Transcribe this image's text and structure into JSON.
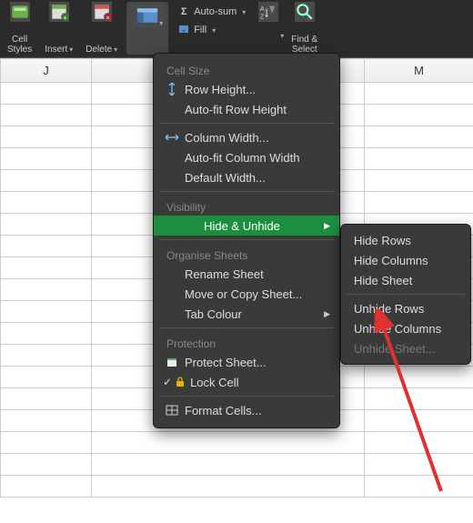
{
  "ribbon": {
    "cell_styles": "Cell\nStyles",
    "insert": "Insert",
    "delete": "Delete",
    "autosum": "Auto-sum",
    "fill": "Fill",
    "find_select": "Find &\nSelect"
  },
  "columns": [
    "J",
    "M"
  ],
  "menu": {
    "sections": {
      "cell_size": "Cell Size",
      "visibility": "Visibility",
      "organise": "Organise Sheets",
      "protection": "Protection"
    },
    "items": {
      "row_height": "Row Height...",
      "autofit_row": "Auto-fit Row Height",
      "column_width": "Column Width...",
      "autofit_col": "Auto-fit Column Width",
      "default_width": "Default Width...",
      "hide_unhide": "Hide & Unhide",
      "rename_sheet": "Rename Sheet",
      "move_copy": "Move or Copy Sheet...",
      "tab_colour": "Tab Colour",
      "protect_sheet": "Protect Sheet...",
      "lock_cell": "Lock Cell",
      "format_cells": "Format Cells..."
    }
  },
  "submenu": {
    "hide_rows": "Hide Rows",
    "hide_columns": "Hide Columns",
    "hide_sheet": "Hide Sheet",
    "unhide_rows": "Unhide Rows",
    "unhide_columns": "Unhide Columns",
    "unhide_sheet": "Unhide Sheet..."
  }
}
